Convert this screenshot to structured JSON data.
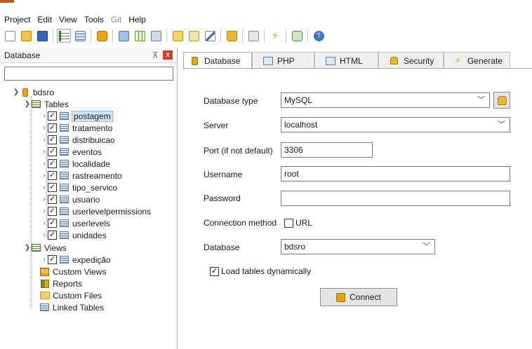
{
  "menu": {
    "items": [
      {
        "label": "Project",
        "enabled": true
      },
      {
        "label": "Edit",
        "enabled": true
      },
      {
        "label": "View",
        "enabled": true
      },
      {
        "label": "Tools",
        "enabled": true
      },
      {
        "label": "Git",
        "enabled": false
      },
      {
        "label": "Help",
        "enabled": true
      }
    ]
  },
  "left_panel": {
    "title": "Database",
    "pin_glyph": "⊼",
    "close_glyph": "x",
    "search_value": "",
    "tree": {
      "root": "bdsro",
      "tables_label": "Tables",
      "tables": [
        "postagem",
        "tratamento",
        "distribuicao",
        "eventos",
        "localidade",
        "rastreamento",
        "tipo_servico",
        "usuario",
        "userlevelpermissions",
        "userlevels",
        "unidades"
      ],
      "selected_table": "postagem",
      "views_label": "Views",
      "views": [
        "expedição"
      ],
      "custom_views": "Custom Views",
      "reports": "Reports",
      "custom_files": "Custom Files",
      "linked_tables": "Linked Tables"
    }
  },
  "tabs": [
    {
      "label": "Database",
      "active": true,
      "icon": "database-icon"
    },
    {
      "label": "PHP",
      "active": false,
      "icon": "php-icon"
    },
    {
      "label": "HTML",
      "active": false,
      "icon": "html-icon"
    },
    {
      "label": "Security",
      "active": false,
      "icon": "lock-icon"
    },
    {
      "label": "Generate",
      "active": false,
      "icon": "lightning-icon"
    }
  ],
  "form": {
    "database_type_label": "Database type",
    "database_type_value": "MySQL",
    "server_label": "Server",
    "server_value": "localhost",
    "port_label": "Port (if not default)",
    "port_value": "3306",
    "username_label": "Username",
    "username_value": "root",
    "password_label": "Password",
    "password_value": "",
    "connection_method_label": "Connection method",
    "url_label": "URL",
    "url_checked": false,
    "database_label": "Database",
    "database_value": "bdsro",
    "load_tables_label": "Load tables dynamically",
    "load_tables_checked": true,
    "connect_label": "Connect"
  },
  "colors": {
    "accent_orange": "#e8a317",
    "selection": "#cfe6fb",
    "close_red": "#d43a2f"
  }
}
